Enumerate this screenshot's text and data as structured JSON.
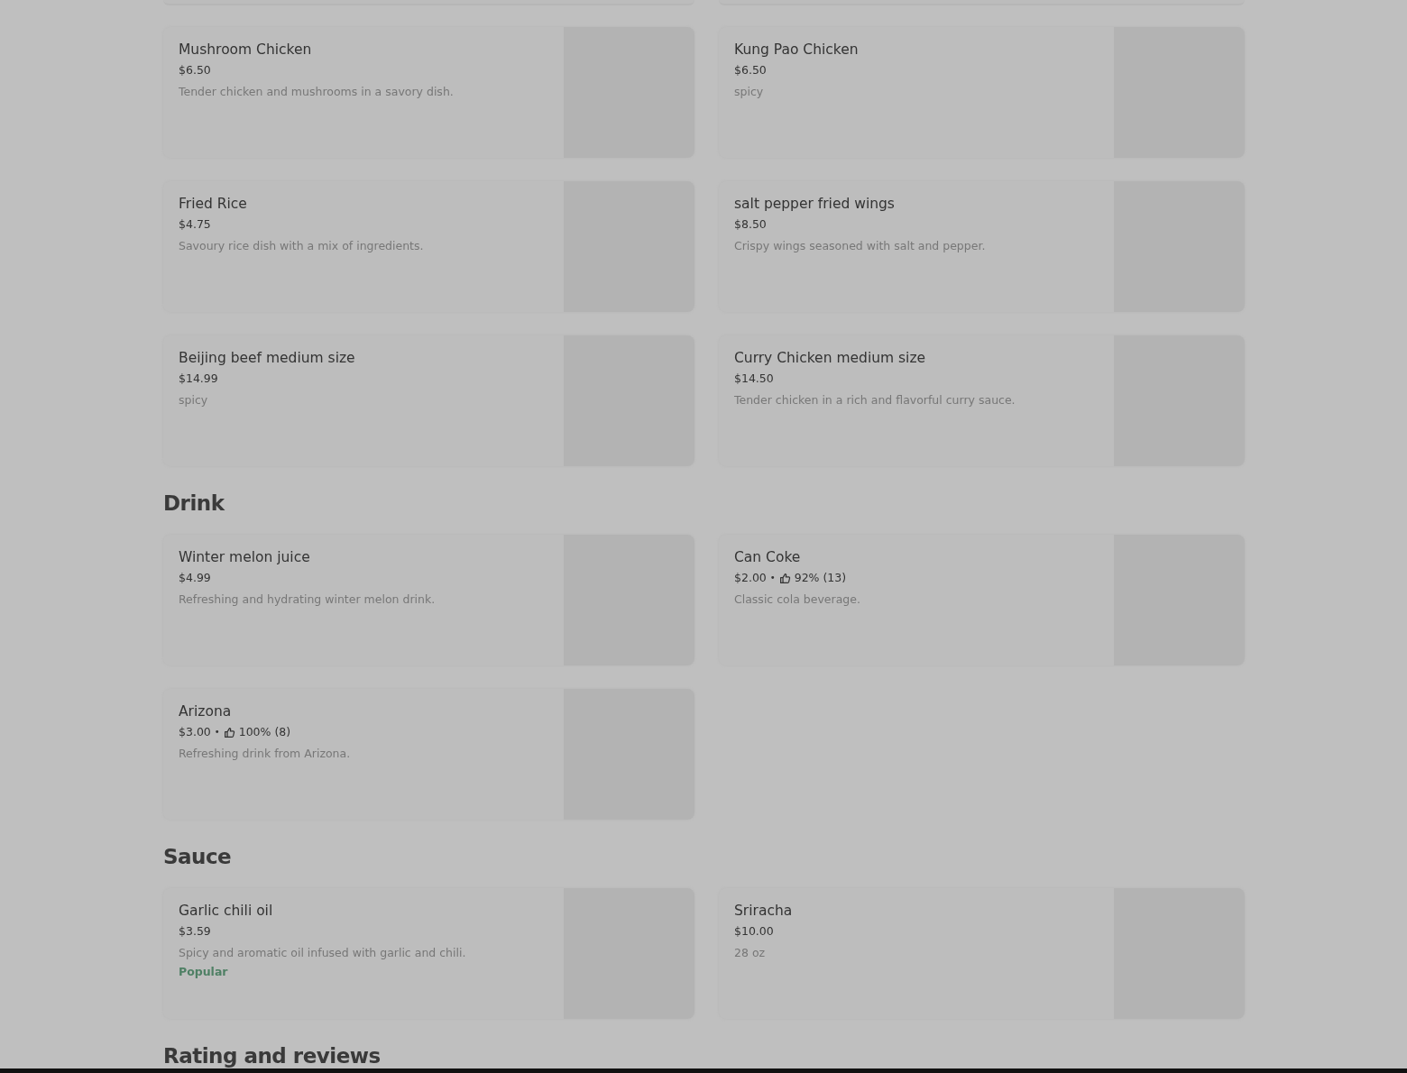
{
  "sections": [
    {
      "items": [
        {
          "name": "Mushroom Chicken",
          "price": "$6.50",
          "description": "Tender chicken and mushrooms in a savory dish."
        },
        {
          "name": "Kung Pao Chicken",
          "price": "$6.50",
          "description": "spicy"
        },
        {
          "name": "Fried Rice",
          "price": "$4.75",
          "description": "Savoury rice dish with a mix of ingredients."
        },
        {
          "name": "salt pepper fried wings",
          "price": "$8.50",
          "description": "Crispy wings seasoned with salt and pepper."
        },
        {
          "name": "Beijing beef medium size",
          "price": "$14.99",
          "description": "spicy"
        },
        {
          "name": "Curry Chicken medium size",
          "price": "$14.50",
          "description": "Tender chicken in a rich and flavorful curry sauce."
        }
      ]
    },
    {
      "heading": "Drink",
      "items": [
        {
          "name": "Winter melon juice",
          "price": "$4.99",
          "description": "Refreshing and hydrating winter melon drink."
        },
        {
          "name": "Can Coke",
          "price": "$2.00",
          "separator": "•",
          "rating": "92% (13)",
          "description": "Classic cola beverage."
        },
        {
          "name": "Arizona",
          "price": "$3.00",
          "separator": "•",
          "rating": "100% (8)",
          "description": "Refreshing drink from Arizona."
        }
      ]
    },
    {
      "heading": "Sauce",
      "items": [
        {
          "name": "Garlic chili oil",
          "price": "$3.59",
          "description": "Spicy and aromatic oil infused with garlic and chili.",
          "badge": "Popular"
        },
        {
          "name": "Sriracha",
          "price": "$10.00",
          "description": "28 oz"
        }
      ]
    },
    {
      "heading": "Rating and reviews"
    }
  ]
}
